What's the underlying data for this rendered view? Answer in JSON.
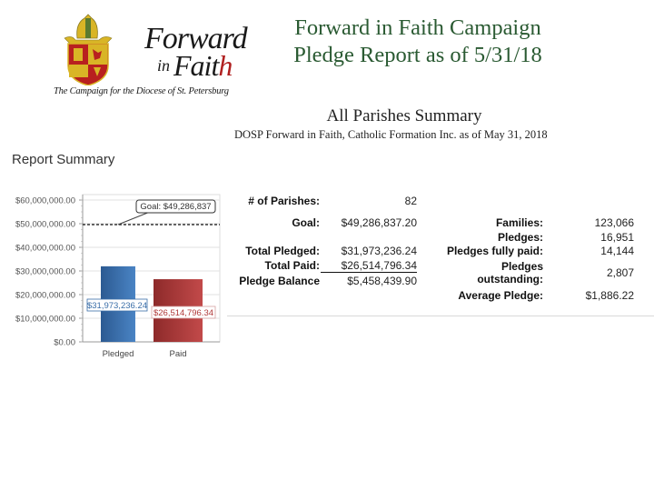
{
  "logo": {
    "word1": "Forward",
    "word2_in": "in",
    "word2_faith_a": "Fait",
    "word2_faith_h": "h",
    "tagline": "The Campaign for the Diocese of St. Petersburg",
    "colors": {
      "shield_red": "#b8201f",
      "gold": "#d9b526"
    }
  },
  "header": {
    "line1": "Forward in Faith Campaign",
    "line2": "Pledge Report as of 5/31/18",
    "color": "#2a5a32"
  },
  "summary": {
    "title": "All Parishes Summary",
    "subtitle": "DOSP Forward in Faith, Catholic Formation Inc.  as of May 31, 2018"
  },
  "report_summary_heading": "Report Summary",
  "stats_left": [
    {
      "label": "# of Parishes:",
      "value": "82"
    },
    {
      "label": "Goal:",
      "value": "$49,286,837.20"
    },
    {
      "label": "Total Pledged:",
      "value": "$31,973,236.24"
    },
    {
      "label": "Total Paid:",
      "value": "$26,514,796.34"
    },
    {
      "label": "Pledge Balance",
      "value": "$5,458,439.90"
    }
  ],
  "stats_right": [
    {
      "label": "Families:",
      "value": "123,066"
    },
    {
      "label": "Pledges:",
      "value": "16,951"
    },
    {
      "label": "Pledges fully paid:",
      "value": "14,144"
    },
    {
      "label_line1": "Pledges",
      "label_line2": "outstanding:",
      "value": "2,807"
    },
    {
      "label": "Average Pledge:",
      "value": "$1,886.22"
    }
  ],
  "chart_data": {
    "type": "bar",
    "title": "Report Summary",
    "categories": [
      "Pledged",
      "Paid"
    ],
    "values": [
      31973236.24,
      26514796.34
    ],
    "data_labels": [
      "$31,973,236.24",
      "$26,514,796.34"
    ],
    "colors": [
      "#3a6ea8",
      "#b03a3a"
    ],
    "ylim": [
      0,
      60000000
    ],
    "yticks": [
      0,
      10000000,
      20000000,
      30000000,
      40000000,
      50000000,
      60000000
    ],
    "ytick_labels": [
      "$0.00",
      "$10,000,000.00",
      "$20,000,000.00",
      "$30,000,000.00",
      "$40,000,000.00",
      "$50,000,000.00",
      "$60,000,000.00"
    ],
    "goal": {
      "value": 49286837,
      "label": "Goal: $49,286,837",
      "style": "dashed"
    },
    "grid": true,
    "xlabel": "",
    "ylabel": ""
  }
}
